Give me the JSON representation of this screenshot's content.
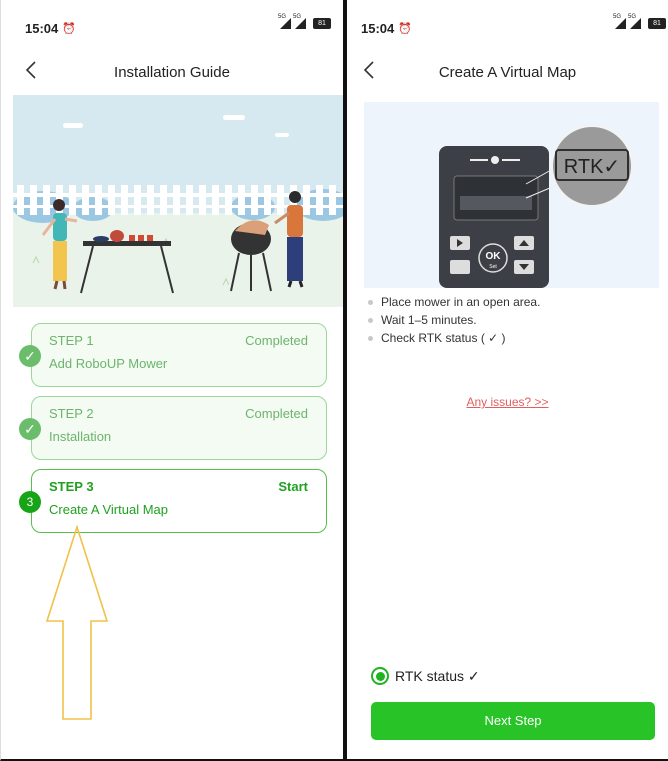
{
  "left": {
    "status": {
      "time": "15:04",
      "net1": "5G",
      "net2": "5G",
      "battery": "81"
    },
    "nav": {
      "back_icon": "chevron-left",
      "title": "Installation Guide"
    },
    "steps": [
      {
        "label": "STEP 1",
        "status": "Completed",
        "name": "Add RoboUP Mower",
        "badge": "✓"
      },
      {
        "label": "STEP 2",
        "status": "Completed",
        "name": "Installation",
        "badge": "✓"
      },
      {
        "label": "STEP 3",
        "status": "Start",
        "name": "Create A Virtual Map",
        "badge": "3"
      }
    ],
    "arrow_color": "#f0c24a"
  },
  "right": {
    "status": {
      "time": "15:04",
      "net1": "5G",
      "net2": "5G",
      "battery": "81"
    },
    "nav": {
      "back_icon": "chevron-left",
      "title": "Create A Virtual Map"
    },
    "device": {
      "rtk_label": "RTK✓",
      "ok_label": "OK",
      "set_label": "Set"
    },
    "instructions": [
      "Place mower in an open area.",
      "Wait 1–5 minutes.",
      "Check RTK status ( ✓ )"
    ],
    "issues_link": "Any issues? >>",
    "rtk_status_label": "RTK status ✓",
    "rtk_status_selected": true,
    "next_button": "Next Step"
  },
  "colors": {
    "accent": "#27c327",
    "completed_green": "#6db46c",
    "link_red": "#e06060"
  }
}
